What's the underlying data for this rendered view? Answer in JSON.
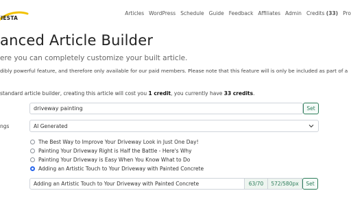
{
  "brand": {
    "logo_text": "FIESTA"
  },
  "nav": {
    "items": [
      "Articles",
      "WordPress",
      "Schedule",
      "Guide",
      "Feedback",
      "Affiliates",
      "Admin"
    ],
    "credits_label": "Credits",
    "credits_count": "(33)",
    "profile_label": "Pro"
  },
  "page": {
    "title": "anced Article Builder",
    "subtitle": "ere you can completely customize your built article.",
    "notice": "dibly powerful feature, and therefore only available for our paid members. Please note that this feature will is only be included as part of a",
    "cost_prefix": "standard article builder, creating this article will cost you ",
    "cost_credit": "1 credit",
    "cost_middle": ", you currently have ",
    "cost_credits_have": "33 credits",
    "cost_suffix": "."
  },
  "keyword": {
    "value": "driveway painting",
    "set_label": "Set"
  },
  "settings": {
    "label": "ngs",
    "selected": "AI Generated"
  },
  "title_options": [
    "The Best Way to Improve Your Driveway Look in Just One Day!",
    "Painting Your Driveway Right is Half the Battle - Here's Why",
    "Painting Your Driveway is Easy When You Know What to Do",
    "Adding an Artistic Touch to Your Driveway with Painted Concrete"
  ],
  "selected_option_index": 3,
  "title_field": {
    "value": "Adding an Artistic Touch to Your Driveway with Painted Concrete",
    "char_count": "63/70",
    "pixel_width": "572/580px",
    "set_label": "Set"
  },
  "colors": {
    "accent_green": "#2e7d5b",
    "radio_blue": "#2563eb",
    "logo_yellow": "#f2c200"
  }
}
